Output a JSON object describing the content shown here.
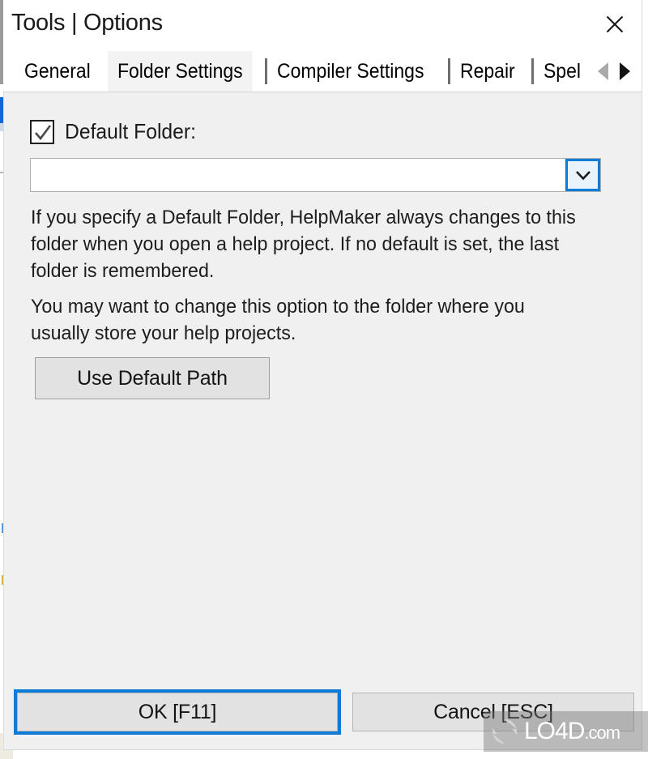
{
  "window": {
    "title": "Tools | Options",
    "close_icon": "close-icon"
  },
  "tabs": {
    "items": [
      {
        "label": "General",
        "selected": false
      },
      {
        "label": "Folder Settings",
        "selected": true
      },
      {
        "label": "Compiler Settings",
        "selected": false
      },
      {
        "label": "Repair",
        "selected": false
      },
      {
        "label": "Spel",
        "selected": false
      }
    ],
    "scroll_left_icon": "triangle-left-icon",
    "scroll_right_icon": "triangle-right-icon",
    "scroll_left_enabled": false,
    "scroll_right_enabled": true
  },
  "panel": {
    "checkbox": {
      "label": "Default Folder:",
      "checked": true,
      "check_icon": "checkmark-icon"
    },
    "combobox": {
      "value": "",
      "placeholder": "",
      "arrow_icon": "chevron-down-icon"
    },
    "help_paragraph_1": "If you specify a Default Folder, HelpMaker always changes to this folder when you open a help project. If no default is set, the last folder is remembered.",
    "help_paragraph_2": "You may want to change this option to the folder where you usually store your help projects.",
    "use_default_path_label": "Use Default Path"
  },
  "footer": {
    "ok_label": "OK [F11]",
    "cancel_label": "Cancel [ESC]"
  },
  "watermark": {
    "name": "LO4D",
    "suffix": ".com"
  },
  "colors": {
    "accent_blue": "#0d7bd8",
    "panel_bg": "#f0f0f0",
    "button_face": "#e2e2e2",
    "title_text": "#1a1a1a",
    "selected_tab_bg": "#f3f3f3"
  }
}
